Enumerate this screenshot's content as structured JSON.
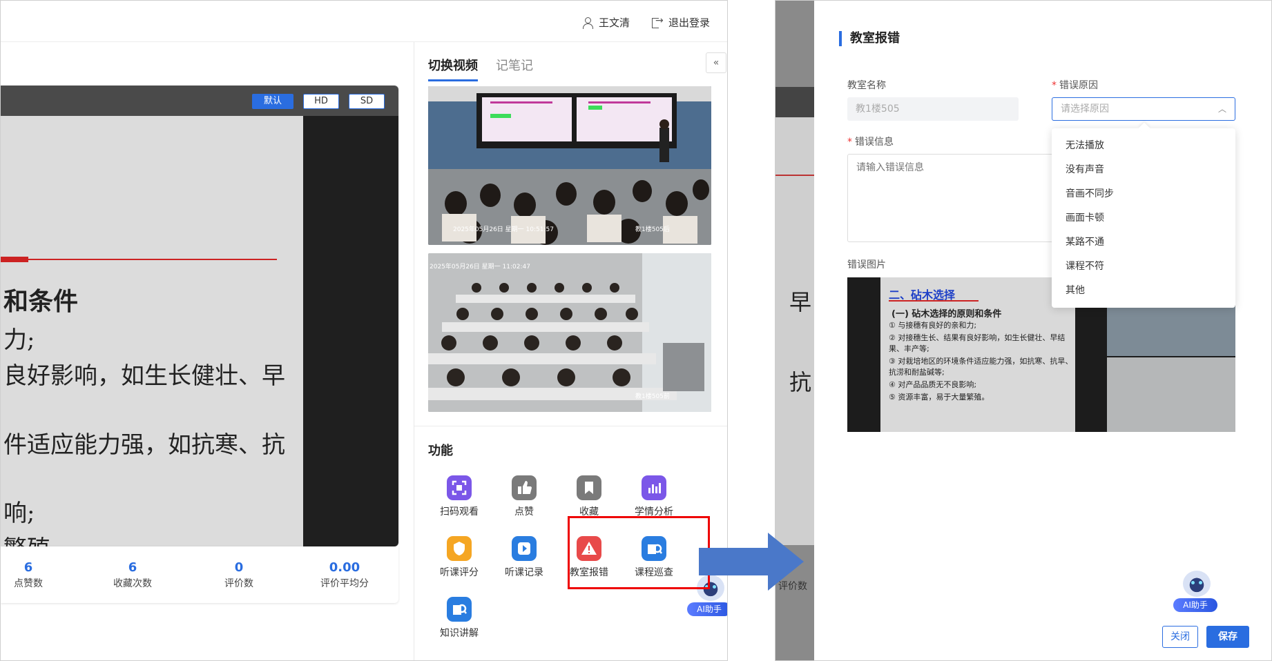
{
  "header": {
    "user_name": "王文清",
    "logout_label": "退出登录"
  },
  "player": {
    "quality_options": [
      "默认",
      "HD",
      "SD"
    ],
    "selected_quality": "默认",
    "slide_lines": [
      "和条件",
      "力;",
      "良好影响，如生长健壮、早",
      "件适应能力强，如抗寒、抗",
      "响;",
      "繁殖。"
    ]
  },
  "stats": [
    {
      "value": "6",
      "label": "点赞数"
    },
    {
      "value": "6",
      "label": "收藏次数"
    },
    {
      "value": "0",
      "label": "评价数"
    },
    {
      "value": "0.00",
      "label": "评价平均分"
    }
  ],
  "side_panel": {
    "tabs": [
      "切换视频",
      "记笔记"
    ],
    "active_tab": "切换视频",
    "collapse_glyph": "«",
    "cam1_overlay": "2025年05月26日 星期一 10:51:57",
    "cam1_room": "教1楼505后",
    "cam2_overlay": "2025年05月26日 星期一 11:02:47",
    "cam2_room": "教1楼505前",
    "functions_title": "功能",
    "functions": [
      {
        "label": "扫码观看",
        "icon": "qr-scan-icon",
        "color": "#7b57e8"
      },
      {
        "label": "点赞",
        "icon": "thumbs-up-icon",
        "color": "#7a7a7a"
      },
      {
        "label": "收藏",
        "icon": "bookmark-icon",
        "color": "#7a7a7a"
      },
      {
        "label": "学情分析",
        "icon": "analytics-icon",
        "color": "#7b57e8"
      },
      {
        "label": "听课评分",
        "icon": "rating-icon",
        "color": "#f5a623"
      },
      {
        "label": "听课记录",
        "icon": "play-record-icon",
        "color": "#2a7de0"
      },
      {
        "label": "教室报错",
        "icon": "warning-icon",
        "color": "#e84a4a"
      },
      {
        "label": "课程巡查",
        "icon": "inspect-icon",
        "color": "#2a7de0"
      },
      {
        "label": "知识讲解",
        "icon": "knowledge-icon",
        "color": "#2a7de0"
      }
    ]
  },
  "ai_assistant": {
    "label": "AI助手"
  },
  "report_form": {
    "title": "教室报错",
    "classroom_label": "教室名称",
    "classroom_value": "教1楼505",
    "reason_label": "错误原因",
    "reason_placeholder": "请选择原因",
    "reason_options": [
      "无法播放",
      "没有声音",
      "音画不同步",
      "画面卡顿",
      "某路不通",
      "课程不符",
      "其他"
    ],
    "info_label": "错误信息",
    "info_placeholder": "请输入错误信息",
    "image_label": "错误图片",
    "image_slide": {
      "title": "二、砧木选择",
      "subtitle": "(一) 砧木选择的原则和条件",
      "items": [
        "① 与接穗有良好的亲和力;",
        "② 对接穗生长、结果有良好影响，如生长健壮、早结果、丰产等;",
        "③ 对栽培地区的环境条件适应能力强，如抗寒、抗旱、抗涝和耐盐碱等;",
        "④ 对产品品质无不良影响;",
        "⑤ 资源丰富，易于大量繁殖。"
      ]
    },
    "close_label": "关闭",
    "save_label": "保存"
  },
  "background_strip": {
    "chars": [
      "早",
      "抗"
    ],
    "bottom_label": "评价数"
  },
  "colors": {
    "primary": "#2a6de0",
    "highlight": "#e00000",
    "required": "#e33333"
  }
}
